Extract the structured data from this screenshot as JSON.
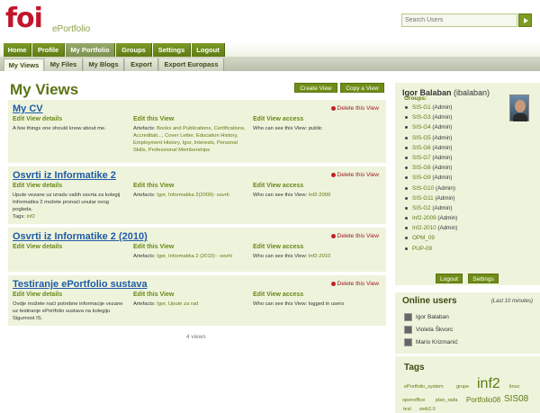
{
  "header": {
    "logo": "foi",
    "site_name": "ePortfolio",
    "search_placeholder": "Search Users"
  },
  "main_nav": [
    "Home",
    "Profile",
    "My Portfolio",
    "Groups",
    "Settings",
    "Logout"
  ],
  "main_nav_active": "My Portfolio",
  "sub_nav": [
    "My Views",
    "My Files",
    "My Blogs",
    "Export",
    "Export Europass"
  ],
  "sub_nav_active": "My Views",
  "page": {
    "title": "My Views",
    "create_view": "Create View",
    "copy_view": "Copy a View",
    "count": "4 views"
  },
  "labels": {
    "edit_details": "Edit View details",
    "edit_this": "Edit this View",
    "edit_access": "Edit View access",
    "delete": "Delete this View",
    "artefacts": "Artefacts:",
    "who_can_see": "Who can see this View:",
    "tags": "Tags:"
  },
  "views": [
    {
      "title": "My CV",
      "description": "A few things one should know about me.",
      "tags": "",
      "artefacts": "Books and Publications, Certifications, Accreditati..., Cover Letter, Education History, Employment History, Igor, Interests, Personal Skills, Professional Memberships",
      "access": "public"
    },
    {
      "title": "Osvrti iz Informatike 2",
      "description": "Upute vezane uz izradu vaših osvrta za kolegij Informatika 2 možete pronaći unutar ovog pogleda.",
      "tags": "inf2",
      "artefacts": "Igor, Informatika 2(2009)- osvrti",
      "access": "Inf2-2009"
    },
    {
      "title": "Osvrti iz Informatike 2 (2010)",
      "description": "",
      "tags": "",
      "artefacts": "Igor, Informatika 2 (2010) - osvrti",
      "access": "Inf2-2010"
    },
    {
      "title": "Testiranje ePortfolio sustava",
      "description": "Ovdje možete naći potrebne informacije vezane uz testiranje ePortfolio sustava na kolegiju Sigurnost IS.",
      "tags": "",
      "artefacts": "Igor, Upute za rad",
      "access": "logged in users"
    }
  ],
  "sidebar": {
    "user_name": "Igor Balaban",
    "user_handle": "(ibalaban)",
    "groups_label": "Groups:",
    "groups": [
      {
        "name": "SIS-G1",
        "role": "(Admin)"
      },
      {
        "name": "SIS-G3",
        "role": "(Admin)"
      },
      {
        "name": "SIS-G4",
        "role": "(Admin)"
      },
      {
        "name": "SIS-G5",
        "role": "(Admin)"
      },
      {
        "name": "SIS-G6",
        "role": "(Admin)"
      },
      {
        "name": "SIS-G7",
        "role": "(Admin)"
      },
      {
        "name": "SIS-G8",
        "role": "(Admin)"
      },
      {
        "name": "SIS-G9",
        "role": "(Admin)"
      },
      {
        "name": "SIS-G10",
        "role": "(Admin)"
      },
      {
        "name": "SIS-G11",
        "role": "(Admin)"
      },
      {
        "name": "SIS-G2",
        "role": "(Admin)"
      },
      {
        "name": "Inf2-2009",
        "role": "(Admin)"
      },
      {
        "name": "Inf2-2010",
        "role": "(Admin)"
      },
      {
        "name": "OPM_09",
        "role": ""
      },
      {
        "name": "PUP-09",
        "role": ""
      }
    ],
    "logout": "Logout",
    "settings": "Settings",
    "online_title": "Online users",
    "online_note": "(Last 10 minutes)",
    "online_users": [
      "Igor Balaban",
      "Violeta Škvorc",
      "Mario Krizmanić"
    ],
    "tags_title": "Tags",
    "tags": [
      "ePortfolio_system",
      "grupe",
      "inf2",
      "linux",
      "openoffice",
      "plan_rada",
      "Portfolio08",
      "SIS08",
      "test",
      "web2.0"
    ]
  },
  "colors": {
    "brand_red": "#c2152b",
    "nav_green": "#6f8d17",
    "panel_bg": "#eef4dc",
    "view_title_blue": "#1f5aa6",
    "delete_red": "#a0171f"
  }
}
